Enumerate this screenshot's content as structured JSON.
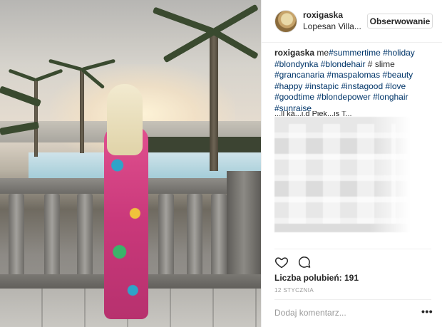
{
  "header": {
    "username": "roxigaska",
    "location": "Lopesan Villa...",
    "follow_label": "Obserwowanie"
  },
  "caption": {
    "author": "roxigaska",
    "lines": [
      [
        "me",
        "#summertime",
        "#holiday"
      ],
      [
        "#blondynka",
        "#blondehair",
        "#",
        "slime"
      ],
      [
        "#grancanaria",
        "#maspalomas",
        "#beauty"
      ],
      [
        "#happy",
        "#instapic",
        "#instagood",
        "#love"
      ],
      [
        "#goodtime",
        "#blondepower",
        "#longhair"
      ],
      [
        "#sunraise"
      ]
    ]
  },
  "comment_fragment": "...ll ká...i.d Piek...is T...",
  "likes_label": "Liczba polubień: 191",
  "date": "12 STYCZNIA",
  "comment_placeholder": "Dodaj komentarz...",
  "more_label": "•••",
  "icons": {
    "like": "heart-icon",
    "comment": "comment-icon",
    "more": "more-options-icon"
  }
}
